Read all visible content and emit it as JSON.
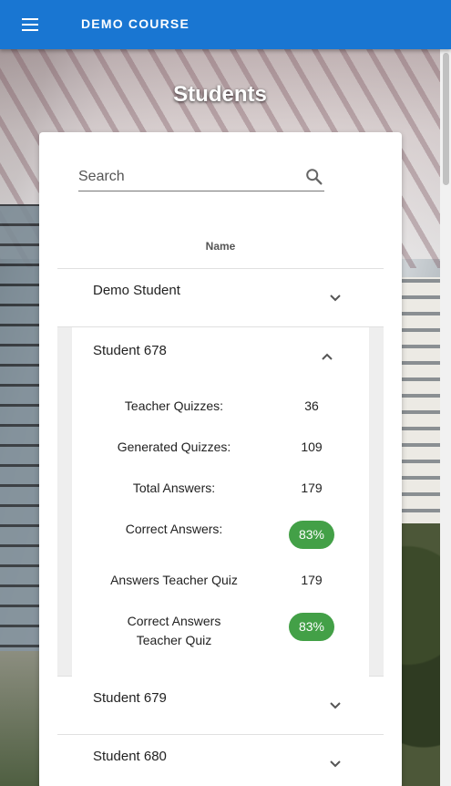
{
  "appbar": {
    "menu_icon": "menu-icon",
    "course_title": "DEMO COURSE",
    "color": "#1976d2"
  },
  "page": {
    "title": "Students"
  },
  "search": {
    "placeholder": "Search",
    "icon": "search-icon"
  },
  "table": {
    "column_header": "Name",
    "rows": [
      {
        "name": "Demo Student",
        "expanded": false
      },
      {
        "name": "Student 678",
        "expanded": true
      },
      {
        "name": "Student 679",
        "expanded": false
      },
      {
        "name": "Student 680",
        "expanded": false
      }
    ]
  },
  "details": {
    "teacher_quizzes": {
      "label": "Teacher Quizzes:",
      "value": "36"
    },
    "generated_quizzes": {
      "label": "Generated Quizzes:",
      "value": "109"
    },
    "total_answers": {
      "label": "Total Answers:",
      "value": "179"
    },
    "correct_answers": {
      "label": "Correct Answers:",
      "value": "83%"
    },
    "answers_teacher_quiz": {
      "label": "Answers Teacher Quiz",
      "value": "179"
    },
    "correct_answers_teacher_quiz": {
      "label": "Correct Answers Teacher Quiz",
      "value": "83%"
    },
    "badge_color": "#43a047"
  }
}
